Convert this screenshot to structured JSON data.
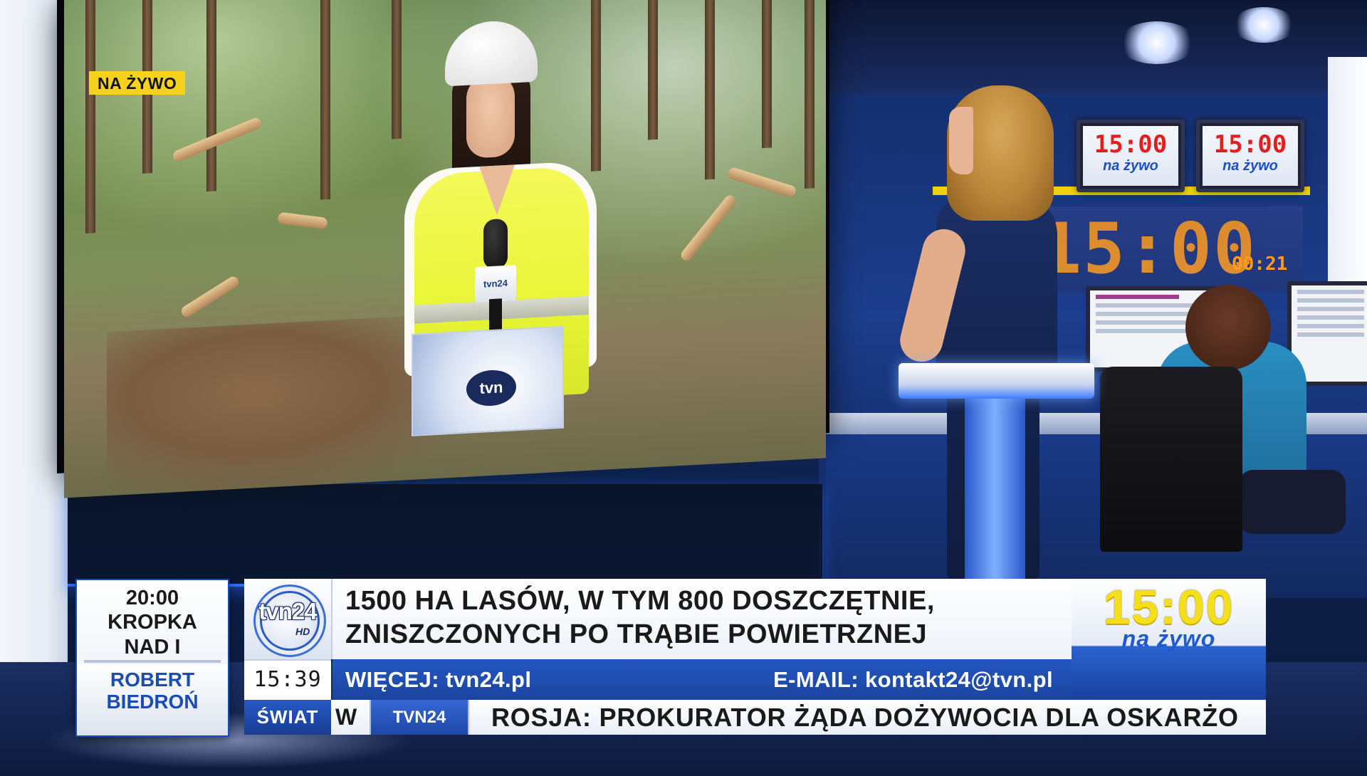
{
  "broadcast": {
    "channel": "TVN24",
    "live_badge": "NA ŻYWO"
  },
  "studio": {
    "monitor_time": "15:00",
    "monitor_sub": "na żywo",
    "big_clock": "15:00",
    "small_timer": "00:21"
  },
  "video_feed": {
    "mic_flag_label": "tvn24",
    "folder_logo": "tvn"
  },
  "up_next": {
    "time": "20:00",
    "show_line1": "KROPKA",
    "show_line2": "NAD I",
    "guest_line1": "ROBERT",
    "guest_line2": "BIEDROŃ"
  },
  "logo": {
    "text": "tvn24",
    "suffix": "HD"
  },
  "headline": {
    "line1": "1500 HA LASÓW, W TYM 800 DOSZCZĘTNIE,",
    "line2": "ZNISZCZONYCH PO TRĄBIE POWIETRZNEJ"
  },
  "clock": {
    "time": "15:39"
  },
  "info_bar": {
    "more": "WIĘCEJ: tvn24.pl",
    "email": "E-MAIL: kontakt24@tvn.pl"
  },
  "promo": {
    "time": "15:00",
    "subtitle": "na żywo"
  },
  "ticker": {
    "section": "ŚWIAT",
    "previous_fragment": "W",
    "brand": "TVN24",
    "text": "ROSJA: PROKURATOR ŻĄDA DOŻYWOCIA DLA OSKARŻO"
  },
  "colors": {
    "brand_blue": "#1b449f",
    "live_yellow": "#f6d21c",
    "promo_yellow": "#f5de1a"
  }
}
